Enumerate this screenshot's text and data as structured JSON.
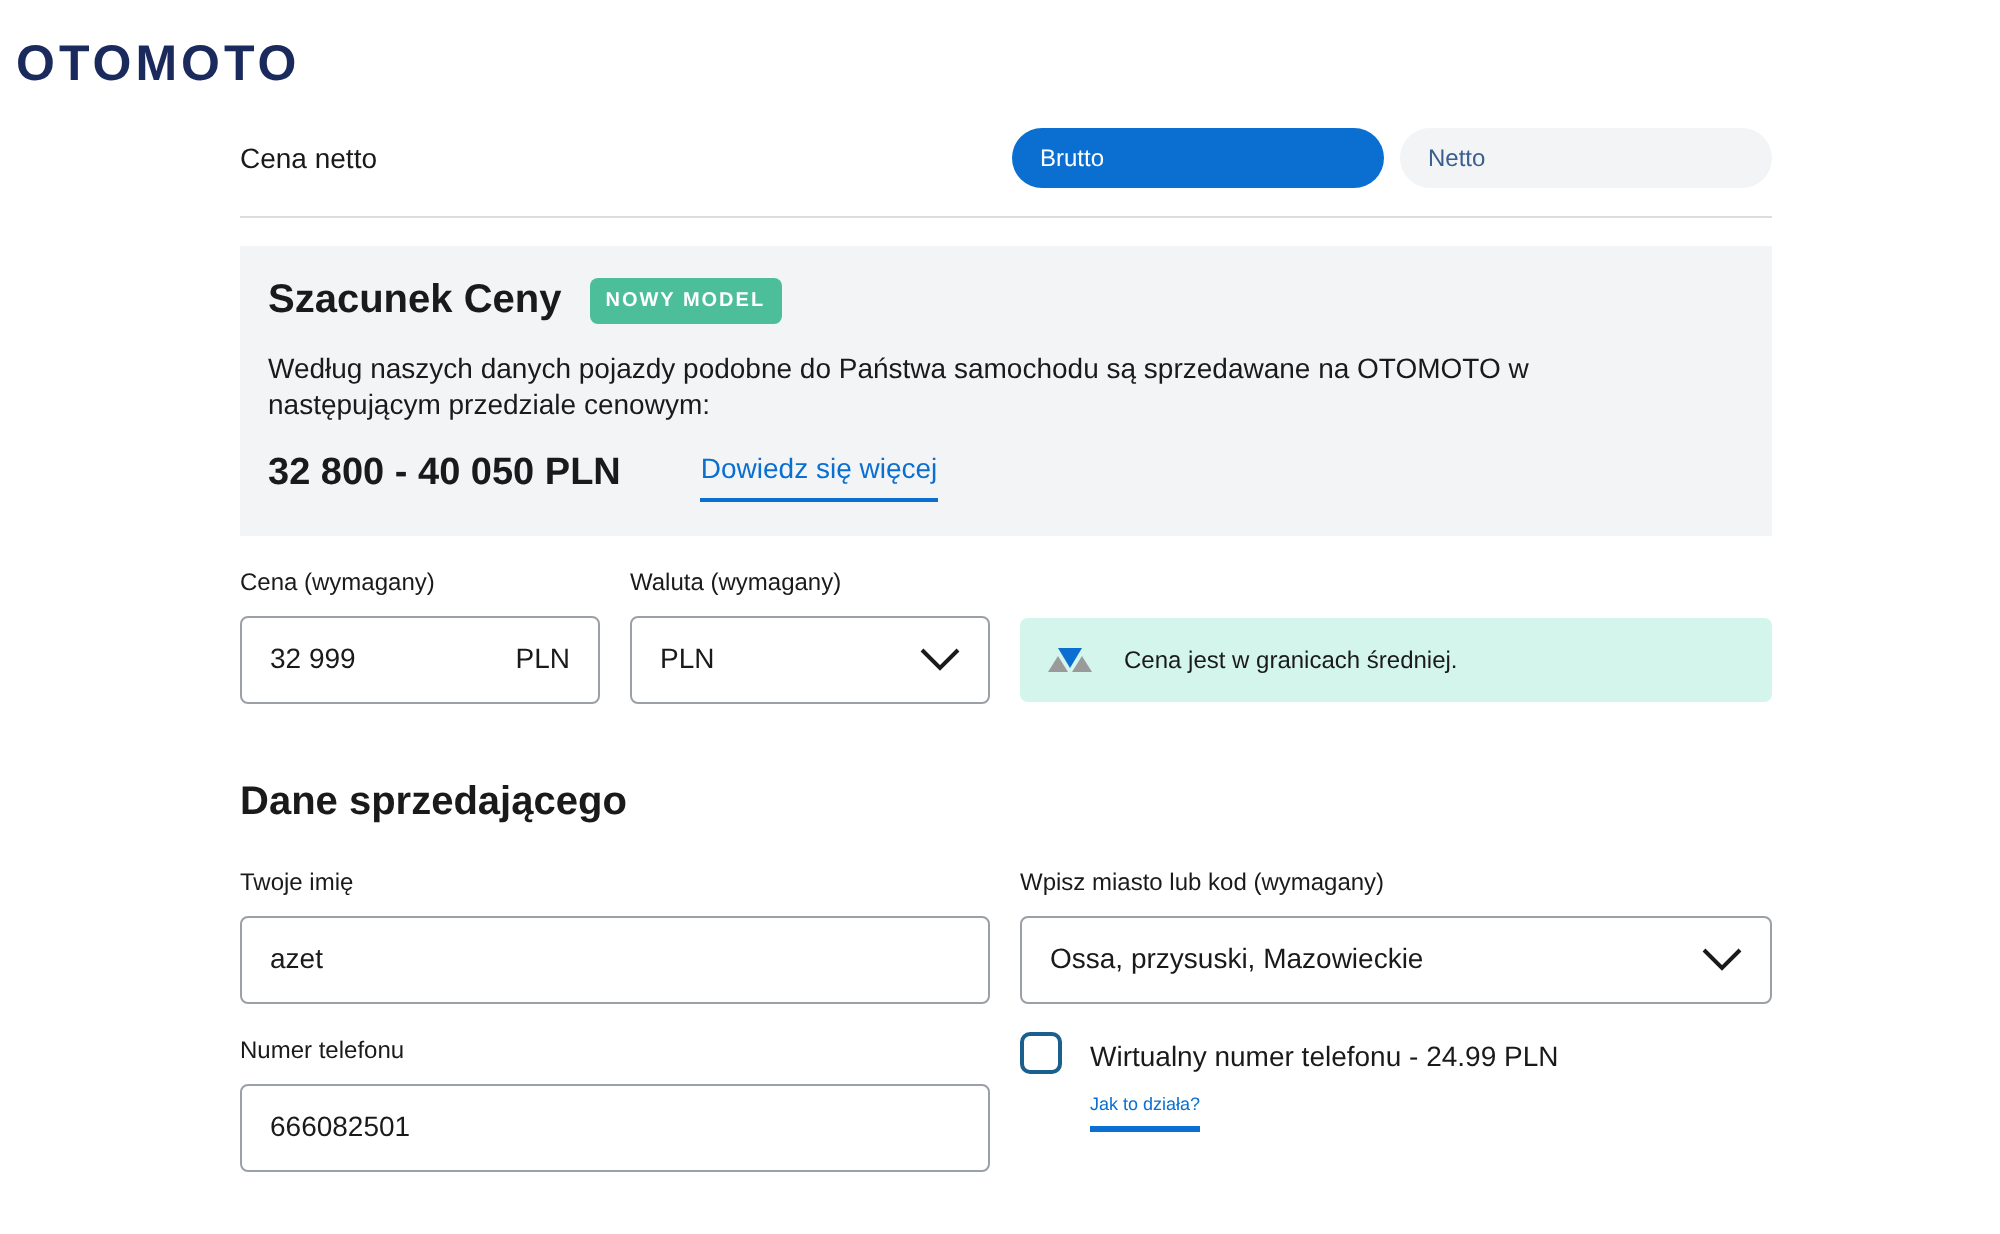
{
  "logo": "OTOMOTO",
  "price_type": {
    "label": "Cena netto",
    "options": [
      {
        "label": "Brutto",
        "selected": true
      },
      {
        "label": "Netto",
        "selected": false
      }
    ]
  },
  "estimate": {
    "title": "Szacunek Ceny",
    "badge": "NOWY MODEL",
    "description": "Według naszych danych pojazdy podobne do Państwa samochodu są sprzedawane na OTOMOTO w następującym przedziale cenowym:",
    "range": "32 800 - 40 050 PLN",
    "link": "Dowiedz się więcej"
  },
  "price": {
    "label": "Cena (wymagany)",
    "value": "32 999",
    "unit": "PLN"
  },
  "currency": {
    "label": "Waluta (wymagany)",
    "value": "PLN"
  },
  "price_info": "Cena jest w granicach średniej.",
  "seller": {
    "title": "Dane sprzedającego",
    "name": {
      "label": "Twoje imię",
      "value": "azet"
    },
    "city": {
      "label": "Wpisz miasto lub kod (wymagany)",
      "value": "Ossa, przysuski, Mazowieckie"
    },
    "phone": {
      "label": "Numer telefonu",
      "value": "666082501"
    },
    "virtual_number": {
      "label": "Wirtualny numer telefonu - 24.99 PLN",
      "checked": false,
      "link": "Jak to działa?"
    }
  }
}
